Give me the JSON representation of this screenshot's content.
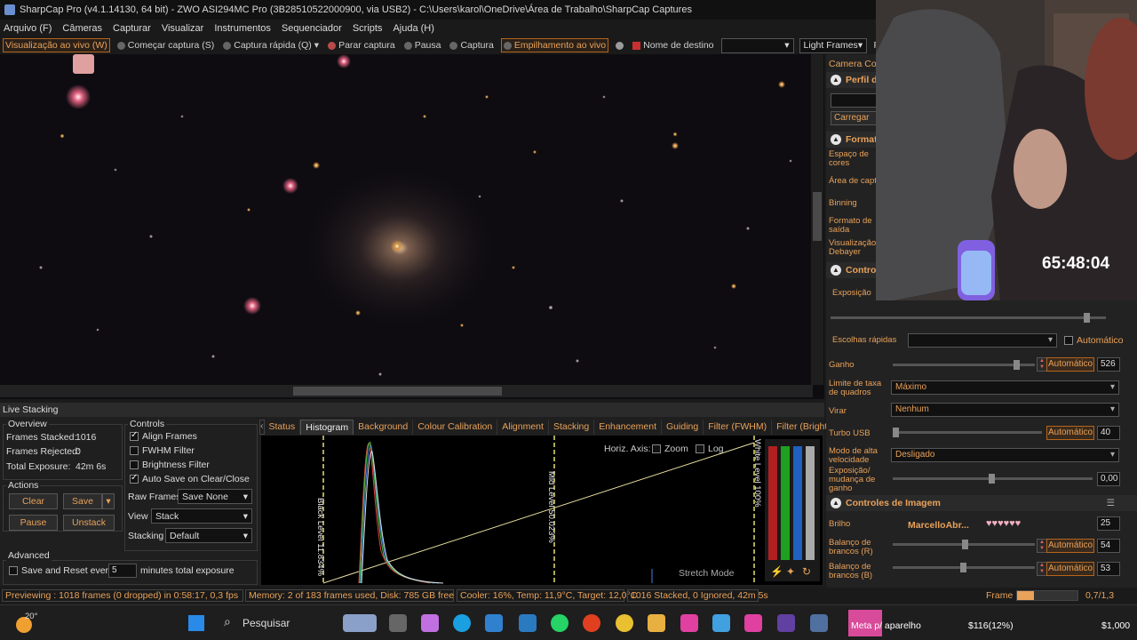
{
  "window": {
    "title": "SharpCap Pro (v4.1.14130, 64 bit) - ZWO ASI294MC Pro (3B28510522000900, via USB2) - C:\\Users\\karol\\OneDrive\\Área de Trabalho\\SharpCap Captures"
  },
  "menu": [
    "Arquivo (F)",
    "Câmeras",
    "Capturar",
    "Visualizar",
    "Instrumentos",
    "Sequenciador",
    "Scripts",
    "Ajuda (H)"
  ],
  "toolbar": {
    "live_view": "Visualização ao vivo (W)",
    "start_capture": "Começar captura (S)",
    "quick_capture": "Captura rápida (Q)",
    "stop_capture": "Parar captura",
    "pause": "Pausa",
    "capture": "Captura",
    "live_stack": "Empilhamento ao vivo",
    "target_name": "Nome de destino",
    "target_value": "",
    "frame_type": "Light Frames",
    "fx": "FX"
  },
  "live_stacking": {
    "header": "Live Stacking",
    "overview": {
      "title": "Overview",
      "frames_stacked_label": "Frames Stacked:",
      "frames_stacked": "1016",
      "frames_rejected_label": "Frames Rejected:",
      "frames_rejected": "0",
      "total_exposure_label": "Total Exposure:",
      "total_exposure": "42m 6s"
    },
    "actions": {
      "title": "Actions",
      "clear": "Clear",
      "save": "Save",
      "pause": "Pause",
      "unstack": "Unstack"
    },
    "advanced": {
      "title": "Advanced",
      "save_reset": "Save and Reset every",
      "minutes_value": "5",
      "minutes_label": "minutes total exposure"
    },
    "controls": {
      "title": "Controls",
      "align_frames": "Align Frames",
      "fwhm_filter": "FWHM Filter",
      "brightness_filter": "Brightness Filter",
      "auto_save": "Auto Save on Clear/Close",
      "raw_frames_label": "Raw Frames",
      "raw_frames_value": "Save None",
      "view_label": "View",
      "view_value": "Stack",
      "stacking_label": "Stacking",
      "stacking_value": "Default"
    },
    "tabs": [
      "Status",
      "Histogram",
      "Background",
      "Colour Calibration",
      "Alignment",
      "Stacking",
      "Enhancement",
      "Guiding",
      "Filter (FWHM)",
      "Filter (Brightness)"
    ],
    "selected_tab": "Histogram",
    "histogram": {
      "horiz_axis": "Horiz. Axis:",
      "zoom": "Zoom",
      "log": "Log",
      "black_level": "Black Level 11.834%",
      "mid_level": "Mid Level 50.023%",
      "white_level": "White Level 100%",
      "stretch_mode": "Stretch Mode"
    }
  },
  "status_bar": {
    "previewing": "Previewing : 1018 frames (0 dropped) in 0:58:17, 0,3 fps",
    "memory": "Memory: 2 of 183 frames used, Disk: 785 GB free",
    "cooler": "Cooler: 16%, Temp: 11,9°C, Target: 12,0°C",
    "stacked": "1016 Stacked, 0 Ignored, 42m 5s",
    "frame_label": "Frame :",
    "frame_value": "0,7/1,3"
  },
  "right_panel": {
    "camera_control": "Camera Con",
    "profile": "Perfil d",
    "load": "Carregar",
    "format": "Format",
    "color_space": "Espaço de cores",
    "capture_area": "Área de capt",
    "binning": "Binning",
    "output_format": "Formato de saída",
    "debayer": "Visualização Debayer",
    "controls": "Control",
    "exposure": "Exposição",
    "quick_choices": "Escolhas rápidas",
    "automatic": "Automático",
    "gain": "Ganho",
    "gain_value": "526",
    "frame_rate_limit": "Limite de taxa de quadros",
    "frame_rate_value": "Máximo",
    "flip": "Virar",
    "flip_value": "Nenhum",
    "usb_turbo": "Turbo USB",
    "usb_turbo_value": "40",
    "high_speed": "Modo de alta velocidade",
    "high_speed_value": "Desligado",
    "exposure_gain_change": "Exposição/ mudança de ganho",
    "exposure_gain_value": "0,00",
    "image_controls": "Controles de Imagem",
    "brightness": "Brilho",
    "brightness_value": "25",
    "wb_red": "Balanço de brancos (R)",
    "wb_red_value": "54",
    "wb_blue": "Balanço de brancos (B)",
    "wb_blue_value": "53",
    "chat_user": "MarcelloAbr..."
  },
  "overlay": {
    "timer": "65:48:04"
  },
  "taskbar": {
    "temperature": "20°",
    "search": "Pesquisar",
    "goal": "Meta p/ aparelho",
    "goal_amount": "$116(12%)",
    "goal_target": "$1,000"
  }
}
